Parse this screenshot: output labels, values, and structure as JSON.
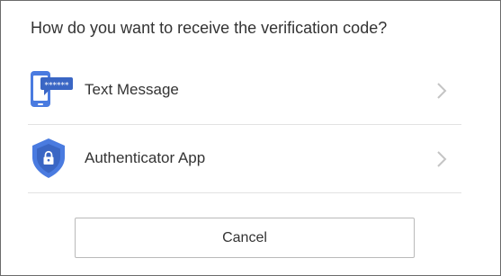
{
  "dialog": {
    "heading": "How do you want to receive the verification code?"
  },
  "options": [
    {
      "label": "Text Message",
      "icon": "sms-phone-icon",
      "chevron": "chevron-right-icon"
    },
    {
      "label": "Authenticator App",
      "icon": "shield-lock-icon",
      "chevron": "chevron-right-icon"
    }
  ],
  "actions": {
    "cancel_label": "Cancel"
  },
  "colors": {
    "accent_blue": "#4a7be0",
    "accent_blue_dark": "#3a66c4",
    "text": "#333333",
    "divider": "#e2e2e2",
    "chevron": "#c4c4c4",
    "button_border": "#b9b9b9"
  }
}
